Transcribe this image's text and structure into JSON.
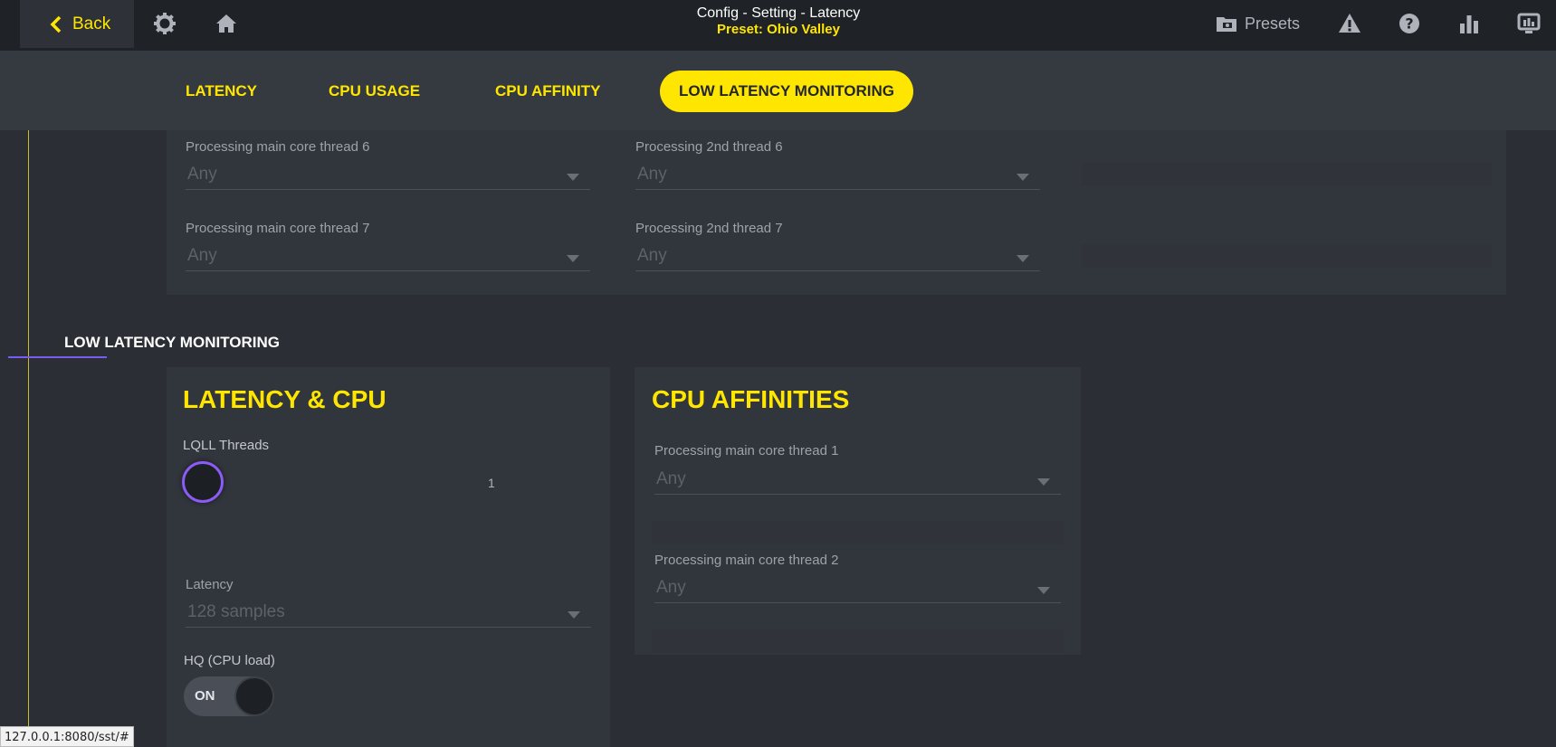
{
  "topbar": {
    "back_label": "Back",
    "title": "Config - Setting - Latency",
    "preset": "Preset: Ohio Valley",
    "presets_label": "Presets"
  },
  "tabs": [
    {
      "label": "LATENCY"
    },
    {
      "label": "CPU USAGE"
    },
    {
      "label": "CPU AFFINITY"
    },
    {
      "label": "LOW LATENCY MONITORING",
      "active": true
    }
  ],
  "affinity_panel": {
    "main6_label": "Processing main core thread 6",
    "main6_value": "Any",
    "second6_label": "Processing 2nd thread 6",
    "second6_value": "Any",
    "main7_label": "Processing main core thread 7",
    "main7_value": "Any",
    "second7_label": "Processing 2nd thread 7",
    "second7_value": "Any"
  },
  "section_title": "LOW LATENCY MONITORING",
  "latency_cpu": {
    "title": "LATENCY & CPU",
    "threads_label": "LQLL Threads",
    "threads_value": "1",
    "latency_label": "Latency",
    "latency_value": "128 samples",
    "hq_label": "HQ (CPU load)",
    "hq_state": "ON"
  },
  "cpu_affinities": {
    "title": "CPU AFFINITIES",
    "main1_label": "Processing main core thread 1",
    "main1_value": "Any",
    "main2_label": "Processing main core thread 2",
    "main2_value": "Any"
  },
  "status_url": "127.0.0.1:8080/sst/#",
  "colors": {
    "accent": "#ffe600",
    "knob_ring": "#8a5cf5",
    "background": "#2b2f35"
  }
}
